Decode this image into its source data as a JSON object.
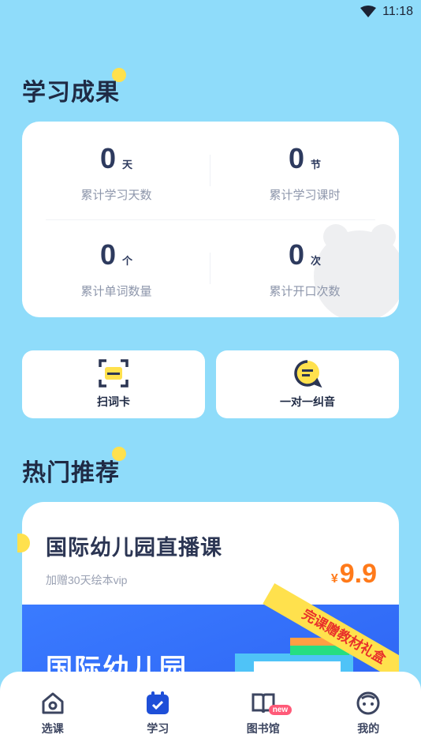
{
  "status": {
    "time": "11:18"
  },
  "achievements": {
    "title": "学习成果",
    "stats": [
      {
        "value": "0",
        "unit": "天",
        "label": "累计学习天数"
      },
      {
        "value": "0",
        "unit": "节",
        "label": "累计学习课时"
      },
      {
        "value": "0",
        "unit": "个",
        "label": "累计单词数量"
      },
      {
        "value": "0",
        "unit": "次",
        "label": "累计开口次数"
      }
    ]
  },
  "tools": [
    {
      "label": "扫词卡",
      "icon": "scan-card-icon"
    },
    {
      "label": "一对一纠音",
      "icon": "chat-bubble-icon"
    }
  ],
  "recommend": {
    "title": "热门推荐",
    "course": {
      "title": "国际幼儿园直播课",
      "subtitle": "加赠30天绘本vip",
      "currency": "¥",
      "price": "9.9",
      "banner_title": "国际幼儿园",
      "banner_ribbon": "完课赠教材礼盒"
    }
  },
  "tabbar": {
    "items": [
      {
        "label": "选课",
        "icon": "home-icon"
      },
      {
        "label": "学习",
        "icon": "calendar-check-icon"
      },
      {
        "label": "图书馆",
        "icon": "book-icon",
        "badge": "new"
      },
      {
        "label": "我的",
        "icon": "face-icon"
      }
    ]
  },
  "colors": {
    "background": "#8fdcfa",
    "accent": "#ffe14d",
    "price": "#ff7a1a",
    "banner": "#3a7bff"
  }
}
